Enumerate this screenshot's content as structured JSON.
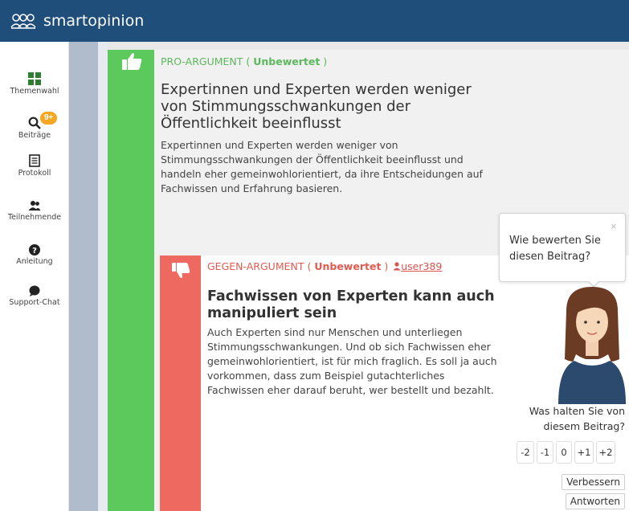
{
  "app": {
    "name": "smartopinion"
  },
  "sidebar": {
    "items": [
      {
        "label": "Themenwahl",
        "icon": "grid-icon"
      },
      {
        "label": "Beiträge",
        "icon": "search-icon",
        "badge": "9+"
      },
      {
        "label": "Protokoll",
        "icon": "document-icon"
      },
      {
        "label": "Teilnehmende",
        "icon": "users-icon"
      },
      {
        "label": "Anleitung",
        "icon": "help-icon"
      },
      {
        "label": "Support-Chat",
        "icon": "chat-icon"
      }
    ]
  },
  "pro": {
    "type_label": "PRO-ARGUMENT",
    "rating": "Unbewertet",
    "title": "Expertinnen und Experten werden weniger von Stimmungsschwankungen der Öffentlichkeit beeinflusst",
    "body": "Expertinnen und Experten werden weniger von Stimmungsschwankungen der Öffentlichkeit beeinflusst und handeln eher gemeinwohlorientiert, da ihre Entscheidungen auf Fachwissen und Erfahrung basieren."
  },
  "contra": {
    "type_label": "GEGEN-ARGUMENT",
    "rating": "Unbewertet",
    "user": "user389",
    "title": "Fachwissen von Experten kann auch manipuliert sein",
    "body": "Auch Experten sind nur Menschen und unterliegen Stimmungsschwankungen. Und ob sich Fachwissen eher gemeinwohlorientiert, ist für mich fraglich. Es soll ja auch vorkommen, dass zum Beispiel gutachterliches Fachwissen eher darauf beruht, wer bestellt und bezahlt."
  },
  "assistant": {
    "tooltip": "Wie bewerten Sie diesen Beitrag?",
    "close": "×",
    "question_line1": "Was halten Sie von",
    "question_line2": "diesem Beitrag?",
    "ratings": [
      "-2",
      "-1",
      "0",
      "+1",
      "+2"
    ],
    "improve_label": "Verbessern",
    "reply_label": "Antworten"
  },
  "colors": {
    "header": "#1f4e7a",
    "pro": "#5cc95c",
    "contra": "#ee6a60"
  }
}
